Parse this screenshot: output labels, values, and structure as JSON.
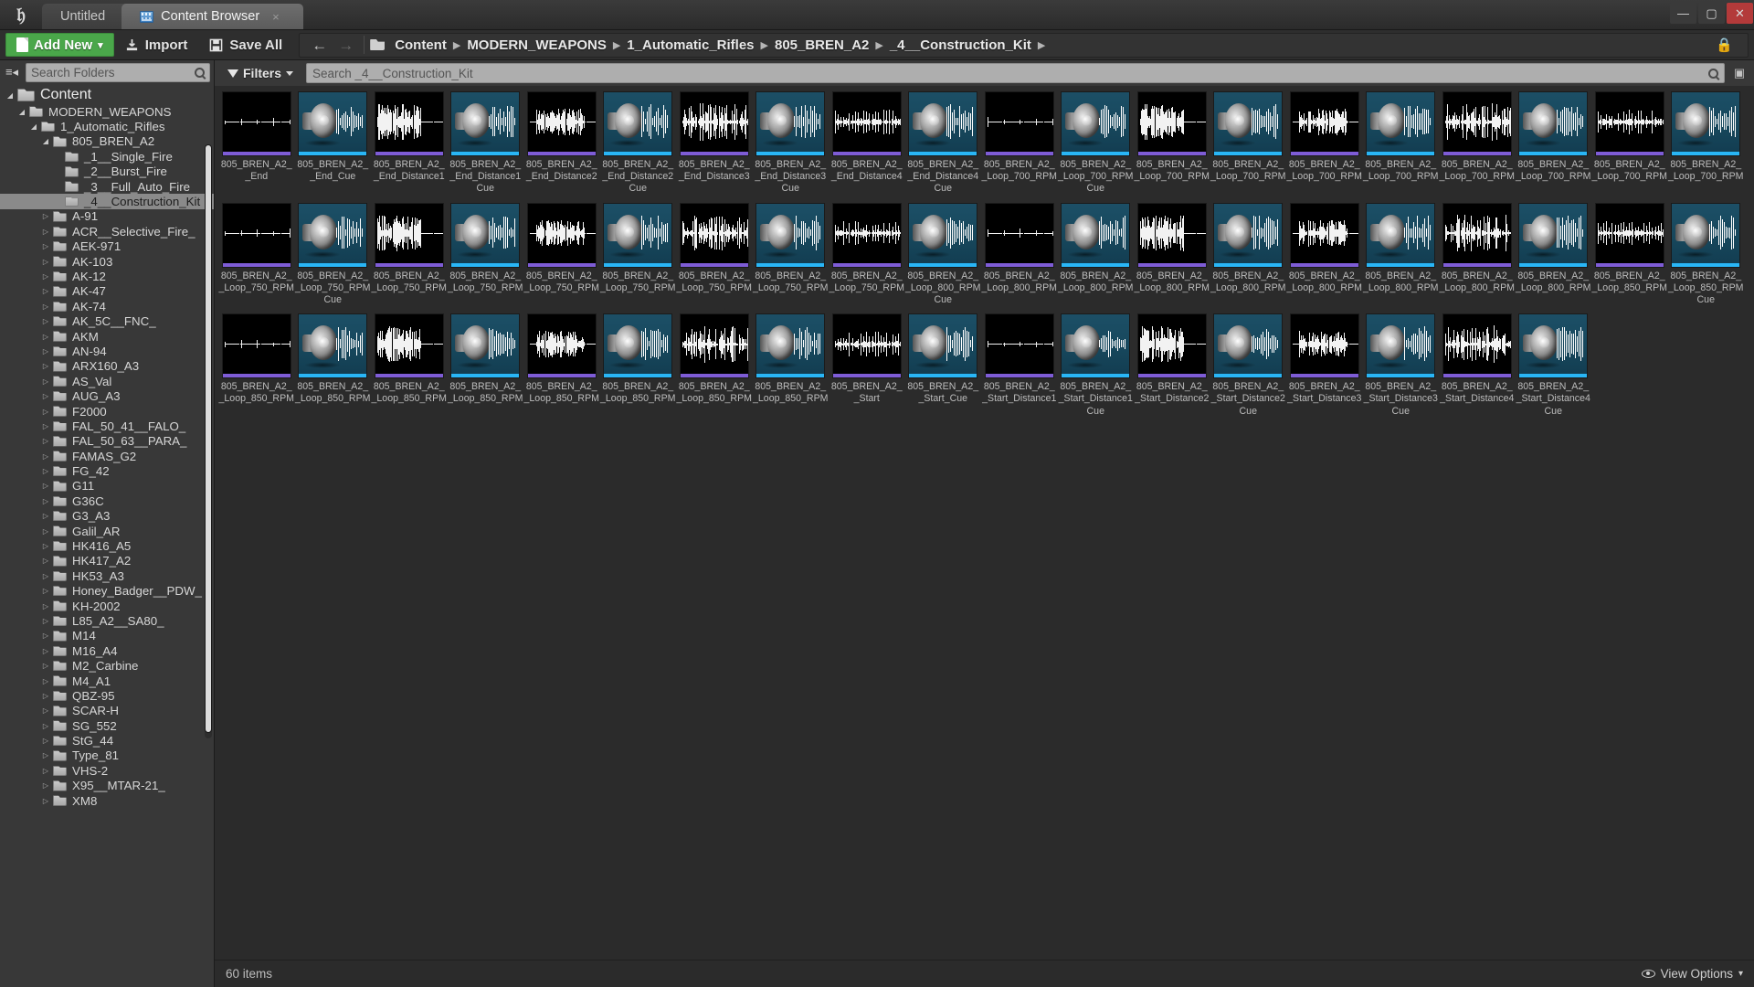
{
  "window": {
    "app_tab": "Untitled",
    "content_tab": "Content Browser",
    "minimize": "—",
    "maximize": "▢",
    "close": "✕",
    "close_tab_glyph": "×"
  },
  "toolbar": {
    "add_new": "Add New",
    "add_new_caret": "▾",
    "import": "Import",
    "save_all": "Save All",
    "back_arrow": "←",
    "forward_arrow": "→",
    "lock_glyph": "🔒"
  },
  "breadcrumb": {
    "items": [
      "Content",
      "MODERN_WEAPONS",
      "1_Automatic_Rifles",
      "805_BREN_A2",
      "_4__Construction_Kit"
    ],
    "separator": "▶"
  },
  "sidebar": {
    "search_placeholder": "Search Folders",
    "tree": [
      {
        "label": "Content",
        "depth": 0,
        "twisty": "open",
        "root": true,
        "selected": false
      },
      {
        "label": "MODERN_WEAPONS",
        "depth": 1,
        "twisty": "open",
        "selected": false
      },
      {
        "label": "1_Automatic_Rifles",
        "depth": 2,
        "twisty": "open",
        "selected": false
      },
      {
        "label": "805_BREN_A2",
        "depth": 3,
        "twisty": "open",
        "selected": false
      },
      {
        "label": "_1__Single_Fire",
        "depth": 4,
        "twisty": "none",
        "selected": false
      },
      {
        "label": "_2__Burst_Fire",
        "depth": 4,
        "twisty": "none",
        "selected": false
      },
      {
        "label": "_3__Full_Auto_Fire",
        "depth": 4,
        "twisty": "none",
        "selected": false
      },
      {
        "label": "_4__Construction_Kit",
        "depth": 4,
        "twisty": "none",
        "selected": true
      },
      {
        "label": "A-91",
        "depth": 3,
        "twisty": "closed",
        "selected": false
      },
      {
        "label": "ACR__Selective_Fire_",
        "depth": 3,
        "twisty": "closed",
        "selected": false
      },
      {
        "label": "AEK-971",
        "depth": 3,
        "twisty": "closed",
        "selected": false
      },
      {
        "label": "AK-103",
        "depth": 3,
        "twisty": "closed",
        "selected": false
      },
      {
        "label": "AK-12",
        "depth": 3,
        "twisty": "closed",
        "selected": false
      },
      {
        "label": "AK-47",
        "depth": 3,
        "twisty": "closed",
        "selected": false
      },
      {
        "label": "AK-74",
        "depth": 3,
        "twisty": "closed",
        "selected": false
      },
      {
        "label": "AK_5C__FNC_",
        "depth": 3,
        "twisty": "closed",
        "selected": false
      },
      {
        "label": "AKM",
        "depth": 3,
        "twisty": "closed",
        "selected": false
      },
      {
        "label": "AN-94",
        "depth": 3,
        "twisty": "closed",
        "selected": false
      },
      {
        "label": "ARX160_A3",
        "depth": 3,
        "twisty": "closed",
        "selected": false
      },
      {
        "label": "AS_Val",
        "depth": 3,
        "twisty": "closed",
        "selected": false
      },
      {
        "label": "AUG_A3",
        "depth": 3,
        "twisty": "closed",
        "selected": false
      },
      {
        "label": "F2000",
        "depth": 3,
        "twisty": "closed",
        "selected": false
      },
      {
        "label": "FAL_50_41__FALO_",
        "depth": 3,
        "twisty": "closed",
        "selected": false
      },
      {
        "label": "FAL_50_63__PARA_",
        "depth": 3,
        "twisty": "closed",
        "selected": false
      },
      {
        "label": "FAMAS_G2",
        "depth": 3,
        "twisty": "closed",
        "selected": false
      },
      {
        "label": "FG_42",
        "depth": 3,
        "twisty": "closed",
        "selected": false
      },
      {
        "label": "G11",
        "depth": 3,
        "twisty": "closed",
        "selected": false
      },
      {
        "label": "G36C",
        "depth": 3,
        "twisty": "closed",
        "selected": false
      },
      {
        "label": "G3_A3",
        "depth": 3,
        "twisty": "closed",
        "selected": false
      },
      {
        "label": "Galil_AR",
        "depth": 3,
        "twisty": "closed",
        "selected": false
      },
      {
        "label": "HK416_A5",
        "depth": 3,
        "twisty": "closed",
        "selected": false
      },
      {
        "label": "HK417_A2",
        "depth": 3,
        "twisty": "closed",
        "selected": false
      },
      {
        "label": "HK53_A3",
        "depth": 3,
        "twisty": "closed",
        "selected": false
      },
      {
        "label": "Honey_Badger__PDW_",
        "depth": 3,
        "twisty": "closed",
        "selected": false
      },
      {
        "label": "KH-2002",
        "depth": 3,
        "twisty": "closed",
        "selected": false
      },
      {
        "label": "L85_A2__SA80_",
        "depth": 3,
        "twisty": "closed",
        "selected": false
      },
      {
        "label": "M14",
        "depth": 3,
        "twisty": "closed",
        "selected": false
      },
      {
        "label": "M16_A4",
        "depth": 3,
        "twisty": "closed",
        "selected": false
      },
      {
        "label": "M2_Carbine",
        "depth": 3,
        "twisty": "closed",
        "selected": false
      },
      {
        "label": "M4_A1",
        "depth": 3,
        "twisty": "closed",
        "selected": false
      },
      {
        "label": "QBZ-95",
        "depth": 3,
        "twisty": "closed",
        "selected": false
      },
      {
        "label": "SCAR-H",
        "depth": 3,
        "twisty": "closed",
        "selected": false
      },
      {
        "label": "SG_552",
        "depth": 3,
        "twisty": "closed",
        "selected": false
      },
      {
        "label": "StG_44",
        "depth": 3,
        "twisty": "closed",
        "selected": false
      },
      {
        "label": "Type_81",
        "depth": 3,
        "twisty": "closed",
        "selected": false
      },
      {
        "label": "VHS-2",
        "depth": 3,
        "twisty": "closed",
        "selected": false
      },
      {
        "label": "X95__MTAR-21_",
        "depth": 3,
        "twisty": "closed",
        "selected": false
      },
      {
        "label": "XM8",
        "depth": 3,
        "twisty": "closed",
        "selected": false
      }
    ]
  },
  "filters": {
    "label": "Filters",
    "caret": "▾",
    "search_placeholder": "Search _4__Construction_Kit"
  },
  "status": {
    "item_count": "60 items",
    "view_options": "View Options",
    "view_options_caret": "▾"
  },
  "assets": [
    {
      "name": "805_BREN_A2__End",
      "type": "wave"
    },
    {
      "name": "805_BREN_A2__End_Cue",
      "type": "cue"
    },
    {
      "name": "805_BREN_A2__End_Distance1",
      "type": "wave"
    },
    {
      "name": "805_BREN_A2__End_Distance1 Cue",
      "type": "cue"
    },
    {
      "name": "805_BREN_A2__End_Distance2",
      "type": "wave"
    },
    {
      "name": "805_BREN_A2__End_Distance2 Cue",
      "type": "cue"
    },
    {
      "name": "805_BREN_A2__End_Distance3",
      "type": "wave"
    },
    {
      "name": "805_BREN_A2__End_Distance3 Cue",
      "type": "cue"
    },
    {
      "name": "805_BREN_A2__End_Distance4",
      "type": "wave"
    },
    {
      "name": "805_BREN_A2__End_Distance4 Cue",
      "type": "cue"
    },
    {
      "name": "805_BREN_A2__Loop_700_RPM",
      "type": "wave"
    },
    {
      "name": "805_BREN_A2__Loop_700_RPM Cue",
      "type": "cue"
    },
    {
      "name": "805_BREN_A2__Loop_700_RPM",
      "type": "wave"
    },
    {
      "name": "805_BREN_A2__Loop_700_RPM",
      "type": "cue"
    },
    {
      "name": "805_BREN_A2__Loop_700_RPM",
      "type": "wave"
    },
    {
      "name": "805_BREN_A2__Loop_700_RPM",
      "type": "cue"
    },
    {
      "name": "805_BREN_A2__Loop_700_RPM",
      "type": "wave"
    },
    {
      "name": "805_BREN_A2__Loop_700_RPM",
      "type": "cue"
    },
    {
      "name": "805_BREN_A2__Loop_700_RPM",
      "type": "wave"
    },
    {
      "name": "805_BREN_A2__Loop_700_RPM",
      "type": "cue"
    },
    {
      "name": "805_BREN_A2__Loop_750_RPM",
      "type": "wave"
    },
    {
      "name": "805_BREN_A2__Loop_750_RPM Cue",
      "type": "cue"
    },
    {
      "name": "805_BREN_A2__Loop_750_RPM",
      "type": "wave"
    },
    {
      "name": "805_BREN_A2__Loop_750_RPM",
      "type": "cue"
    },
    {
      "name": "805_BREN_A2__Loop_750_RPM",
      "type": "wave"
    },
    {
      "name": "805_BREN_A2__Loop_750_RPM",
      "type": "cue"
    },
    {
      "name": "805_BREN_A2__Loop_750_RPM",
      "type": "wave"
    },
    {
      "name": "805_BREN_A2__Loop_750_RPM",
      "type": "cue"
    },
    {
      "name": "805_BREN_A2__Loop_750_RPM",
      "type": "wave"
    },
    {
      "name": "805_BREN_A2__Loop_800_RPM Cue",
      "type": "cue"
    },
    {
      "name": "805_BREN_A2__Loop_800_RPM",
      "type": "wave"
    },
    {
      "name": "805_BREN_A2__Loop_800_RPM",
      "type": "cue"
    },
    {
      "name": "805_BREN_A2__Loop_800_RPM",
      "type": "wave"
    },
    {
      "name": "805_BREN_A2__Loop_800_RPM",
      "type": "cue"
    },
    {
      "name": "805_BREN_A2__Loop_800_RPM",
      "type": "wave"
    },
    {
      "name": "805_BREN_A2__Loop_800_RPM",
      "type": "cue"
    },
    {
      "name": "805_BREN_A2__Loop_800_RPM",
      "type": "wave"
    },
    {
      "name": "805_BREN_A2__Loop_800_RPM",
      "type": "cue"
    },
    {
      "name": "805_BREN_A2__Loop_850_RPM",
      "type": "wave"
    },
    {
      "name": "805_BREN_A2__Loop_850_RPM Cue",
      "type": "cue"
    },
    {
      "name": "805_BREN_A2__Loop_850_RPM",
      "type": "wave"
    },
    {
      "name": "805_BREN_A2__Loop_850_RPM",
      "type": "cue"
    },
    {
      "name": "805_BREN_A2__Loop_850_RPM",
      "type": "wave"
    },
    {
      "name": "805_BREN_A2__Loop_850_RPM",
      "type": "cue"
    },
    {
      "name": "805_BREN_A2__Loop_850_RPM",
      "type": "wave"
    },
    {
      "name": "805_BREN_A2__Loop_850_RPM",
      "type": "cue"
    },
    {
      "name": "805_BREN_A2__Loop_850_RPM",
      "type": "wave"
    },
    {
      "name": "805_BREN_A2__Loop_850_RPM",
      "type": "cue"
    },
    {
      "name": "805_BREN_A2__Start",
      "type": "wave"
    },
    {
      "name": "805_BREN_A2__Start_Cue",
      "type": "cue"
    },
    {
      "name": "805_BREN_A2__Start_Distance1",
      "type": "wave"
    },
    {
      "name": "805_BREN_A2__Start_Distance1 Cue",
      "type": "cue"
    },
    {
      "name": "805_BREN_A2__Start_Distance2",
      "type": "wave"
    },
    {
      "name": "805_BREN_A2__Start_Distance2 Cue",
      "type": "cue"
    },
    {
      "name": "805_BREN_A2__Start_Distance3",
      "type": "wave"
    },
    {
      "name": "805_BREN_A2__Start_Distance3 Cue",
      "type": "cue"
    },
    {
      "name": "805_BREN_A2__Start_Distance4",
      "type": "wave"
    },
    {
      "name": "805_BREN_A2__Start_Distance4 Cue",
      "type": "cue"
    }
  ]
}
